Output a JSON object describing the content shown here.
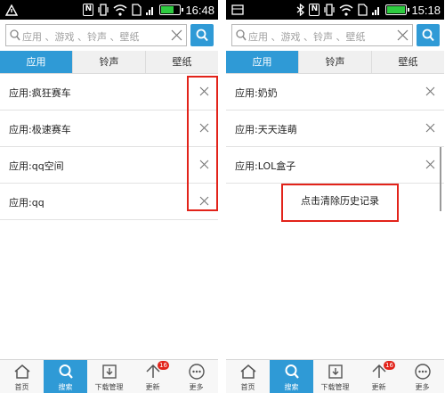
{
  "left_screen": {
    "status_time": "16:48",
    "search_placeholder": "应用 、游戏 、铃声 、壁纸",
    "tabs": [
      {
        "label": "应用",
        "active": true
      },
      {
        "label": "铃声",
        "active": false
      },
      {
        "label": "壁纸",
        "active": false
      }
    ],
    "history": [
      {
        "label": "应用:疯狂赛车"
      },
      {
        "label": "应用:极速赛车"
      },
      {
        "label": "应用:qq空间"
      },
      {
        "label": "应用:qq"
      }
    ],
    "nav": [
      {
        "label": "首页",
        "icon": "home-icon",
        "active": false
      },
      {
        "label": "搜索",
        "icon": "search-icon",
        "active": true
      },
      {
        "label": "下载管理",
        "icon": "download-icon",
        "active": false
      },
      {
        "label": "更新",
        "icon": "update-icon",
        "active": false,
        "badge": "16"
      },
      {
        "label": "更多",
        "icon": "more-icon",
        "active": false
      }
    ]
  },
  "right_screen": {
    "status_time": "15:18",
    "search_placeholder": "应用 、游戏 、铃声 、壁纸",
    "tabs": [
      {
        "label": "应用",
        "active": true
      },
      {
        "label": "铃声",
        "active": false
      },
      {
        "label": "壁纸",
        "active": false
      }
    ],
    "history": [
      {
        "label": "应用:奶奶"
      },
      {
        "label": "应用:天天连萌"
      },
      {
        "label": "应用:LOL盒子"
      }
    ],
    "clear_history_label": "点击清除历史记录",
    "nav": [
      {
        "label": "首页",
        "icon": "home-icon",
        "active": false
      },
      {
        "label": "搜索",
        "icon": "search-icon",
        "active": true
      },
      {
        "label": "下载管理",
        "icon": "download-icon",
        "active": false
      },
      {
        "label": "更新",
        "icon": "update-icon",
        "active": false,
        "badge": "16"
      },
      {
        "label": "更多",
        "icon": "more-icon",
        "active": false
      }
    ]
  },
  "colors": {
    "accent": "#2f9ad6",
    "highlight_box": "#e2231a",
    "badge": "#e2231a"
  }
}
